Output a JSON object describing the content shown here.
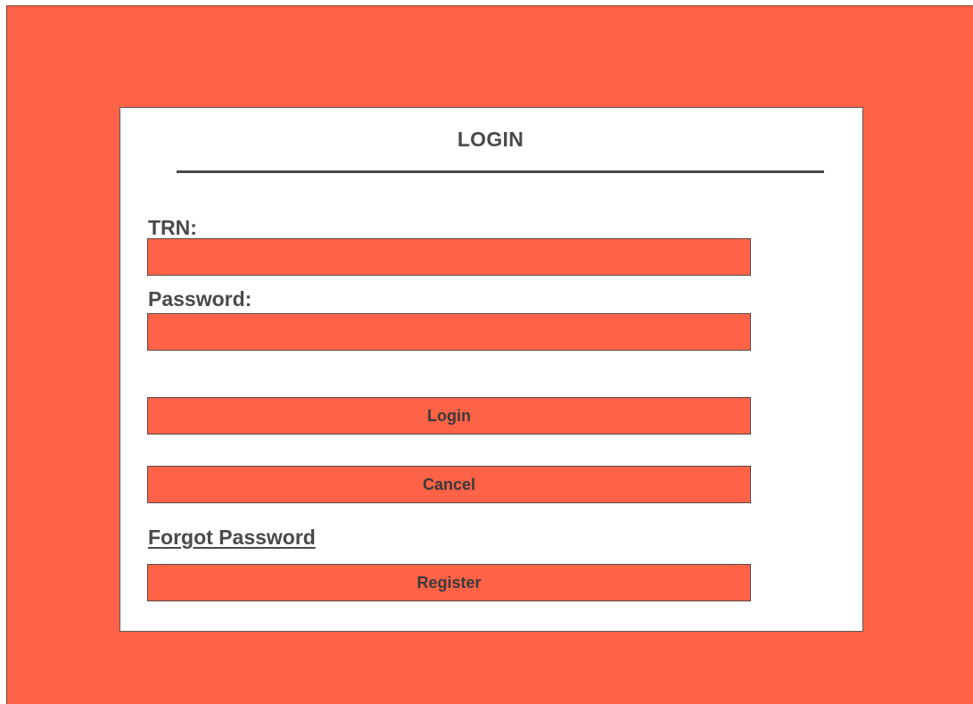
{
  "login_form": {
    "title": "LOGIN",
    "trn_label": "TRN:",
    "trn_value": "",
    "password_label": "Password:",
    "password_value": "",
    "login_button": "Login",
    "cancel_button": "Cancel",
    "forgot_password_link": "Forgot Password",
    "register_button": "Register"
  },
  "colors": {
    "background": "#ff6347",
    "panel": "#ffffff",
    "field_fill": "#ff6347",
    "text": "#4a4a4a"
  }
}
